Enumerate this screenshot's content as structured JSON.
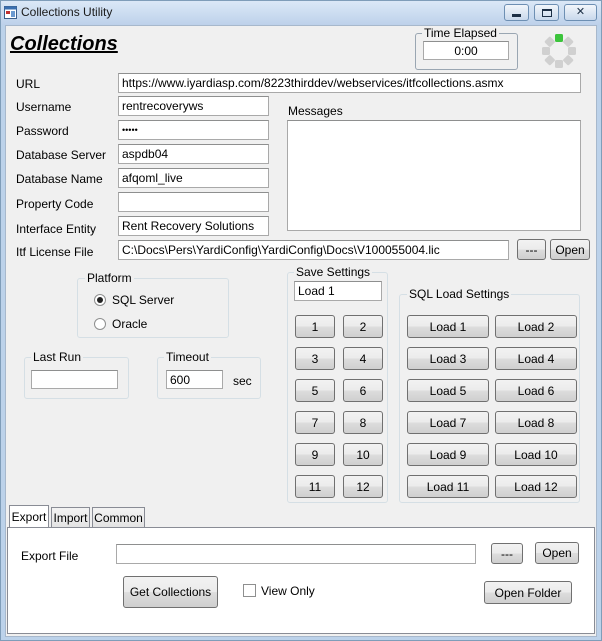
{
  "window": {
    "title": "Collections Utility",
    "controls": {
      "minimize": "▭",
      "maximize": "□",
      "close": "✕"
    }
  },
  "heading": "Collections",
  "time_elapsed": {
    "label": "Time Elapsed",
    "value": "0:00"
  },
  "fields": {
    "url": {
      "label": "URL",
      "value": "https://www.iyardiasp.com/8223thirddev/webservices/itfcollections.asmx"
    },
    "username": {
      "label": "Username",
      "value": "rentrecoveryws"
    },
    "password": {
      "label": "Password",
      "value": "•••••"
    },
    "database_server": {
      "label": "Database Server",
      "value": "aspdb04"
    },
    "database_name": {
      "label": "Database Name",
      "value": "afqoml_live"
    },
    "property_code": {
      "label": "Property Code",
      "value": ""
    },
    "interface_entity": {
      "label": "Interface Entity",
      "value": "Rent Recovery Solutions"
    },
    "license_file": {
      "label": "Itf License File",
      "value": "C:\\Docs\\Pers\\YardiConfig\\YardiConfig\\Docs\\V100055004.lic"
    }
  },
  "license_buttons": {
    "browse": "---",
    "open": "Open"
  },
  "messages": {
    "label": "Messages",
    "value": ""
  },
  "platform": {
    "label": "Platform",
    "options": [
      {
        "label": "SQL Server",
        "selected": true
      },
      {
        "label": "Oracle",
        "selected": false
      }
    ]
  },
  "last_run": {
    "label": "Last Run",
    "value": ""
  },
  "timeout": {
    "label": "Timeout",
    "value": "600",
    "unit": "sec"
  },
  "save_settings": {
    "label": "Save Settings",
    "name_value": "Load 1",
    "buttons": [
      "1",
      "2",
      "3",
      "4",
      "5",
      "6",
      "7",
      "8",
      "9",
      "10",
      "11",
      "12"
    ]
  },
  "sql_load_settings": {
    "label": "SQL Load Settings",
    "buttons": [
      "Load 1",
      "Load 2",
      "Load 3",
      "Load 4",
      "Load 5",
      "Load 6",
      "Load 7",
      "Load 8",
      "Load 9",
      "Load 10",
      "Load 11",
      "Load 12"
    ]
  },
  "tabs": [
    {
      "label": "Export",
      "active": true
    },
    {
      "label": "Import",
      "active": false
    },
    {
      "label": "Common",
      "active": false
    }
  ],
  "export": {
    "file_label": "Export File",
    "file_value": "",
    "browse": "---",
    "open": "Open",
    "get_collections": "Get Collections",
    "view_only_label": "View Only",
    "view_only_checked": false,
    "open_folder": "Open Folder"
  },
  "colors": {
    "spinner_active": "#3cc43c",
    "spinner_idle": "#d0d0d0"
  }
}
